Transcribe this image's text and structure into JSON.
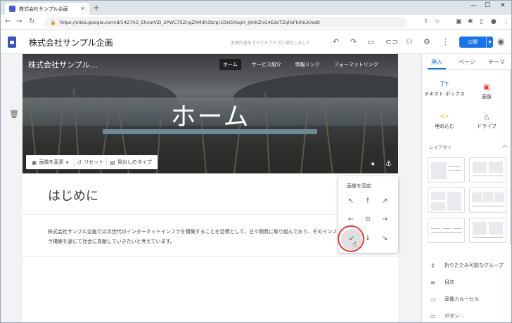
{
  "browser": {
    "tab_title": "株式会社サンプル企画",
    "url": "https://sites.google.com/d/1427hG_EhxoIVZI_2PWC75ZngZhMdh3Iz/p/1DsI5XagH_IJ0rKZnG4EdxTZqFeFk0hLK/edit"
  },
  "sites_header": {
    "site_name": "株式会社サンプル企画",
    "saved_message": "変更内容をすべてドライブに保存しました",
    "publish_label": "公開"
  },
  "page": {
    "site_title": "株式会社サンプル…",
    "nav": [
      "ホーム",
      "サービス紹介",
      "情報リンク",
      "フォーマットリンク"
    ],
    "hero_title": "ホーム",
    "banner_tools": [
      "画像を変更",
      "リセット",
      "見出しのタイプ"
    ],
    "section_title": "はじめに",
    "body_text": "株式会社サンプル企画では次世代のインターネットインフラを構築することを目標として、日々開発に取り組んでおり、そのインフラ構築を通じて社会に貢献していきたいと考えています。"
  },
  "pin_popup": {
    "title": "画像を固定",
    "directions": [
      "↖",
      "↑",
      "↗",
      "←",
      "⊙",
      "→",
      "↙",
      "↓",
      "↘"
    ]
  },
  "right_panel": {
    "tabs": [
      "挿入",
      "ページ",
      "テーマ"
    ],
    "insert_items": [
      {
        "icon": "Tт",
        "label": "テキスト ボックス"
      },
      {
        "icon": "▣",
        "label": "画像"
      },
      {
        "icon": "<>",
        "label": "埋め込む"
      },
      {
        "icon": "△",
        "label": "ドライブ"
      }
    ],
    "layout_label": "レイアウト",
    "components": [
      {
        "icon": "⇕",
        "label": "折りたたみ可能なグループ"
      },
      {
        "icon": "≡",
        "label": "目次"
      },
      {
        "icon": "▭",
        "label": "画像カルーセル"
      },
      {
        "icon": "▭",
        "label": "ボタン"
      }
    ]
  },
  "colors": {
    "accent": "#1a73e8",
    "highlight": "#e53935"
  }
}
